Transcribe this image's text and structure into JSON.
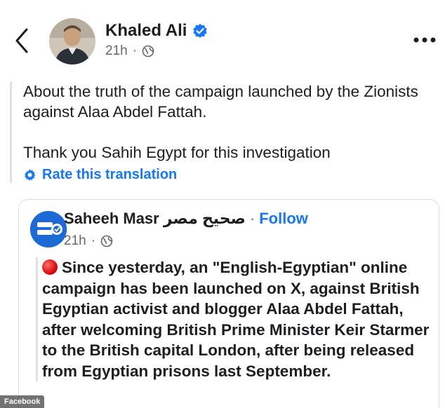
{
  "post": {
    "author": "Khaled Ali",
    "time": "21h",
    "text": "About the truth of the campaign launched by the Zionists against Alaa Abdel Fattah.\n\nThank you Sahih Egypt for this investigation",
    "rate_label": "Rate this translation"
  },
  "shared": {
    "name": "Saheeh Masr صحيح مصر",
    "separator": "·",
    "follow_label": "Follow",
    "time": "21h",
    "text": "Since yesterday, an \"English-Egyptian\" online campaign has been launched on X, against British Egyptian activist and blogger Alaa Abdel Fattah, after welcoming British Prime Minister Keir Starmer to the British capital London, after being released from Egyptian prisons last September."
  },
  "watermark": "Facebook",
  "icons": {
    "back": "chevron-left-icon",
    "verified": "verified-badge-icon",
    "privacy": "globe-icon",
    "more": "more-icon",
    "rate": "gear-icon",
    "bullet": "red-circle-icon"
  },
  "colors": {
    "link": "#1877f2",
    "secondary_text": "#65676b",
    "primary_text": "#1c1e21",
    "alert": "#d40000"
  }
}
